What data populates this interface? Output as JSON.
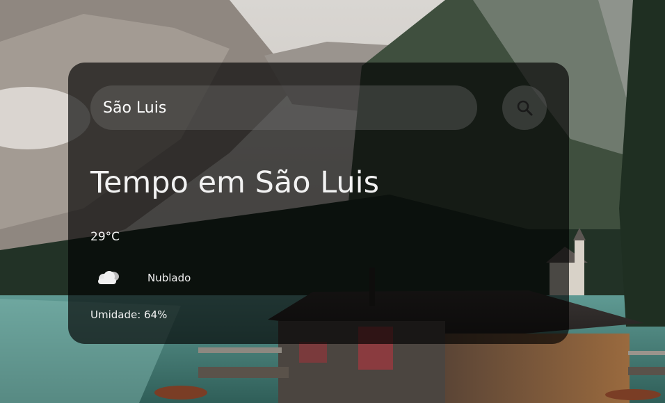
{
  "search": {
    "value": "São Luis",
    "icon": "search-icon"
  },
  "weather": {
    "title": "Tempo em São Luis",
    "temperature": "29°C",
    "icon": "cloud-icon",
    "description": "Nublado",
    "humidity": "Umidade: 64%"
  },
  "colors": {
    "card_background": "#000000A8",
    "input_background": "#7D7D7D52",
    "text": "#F2F2F2"
  }
}
